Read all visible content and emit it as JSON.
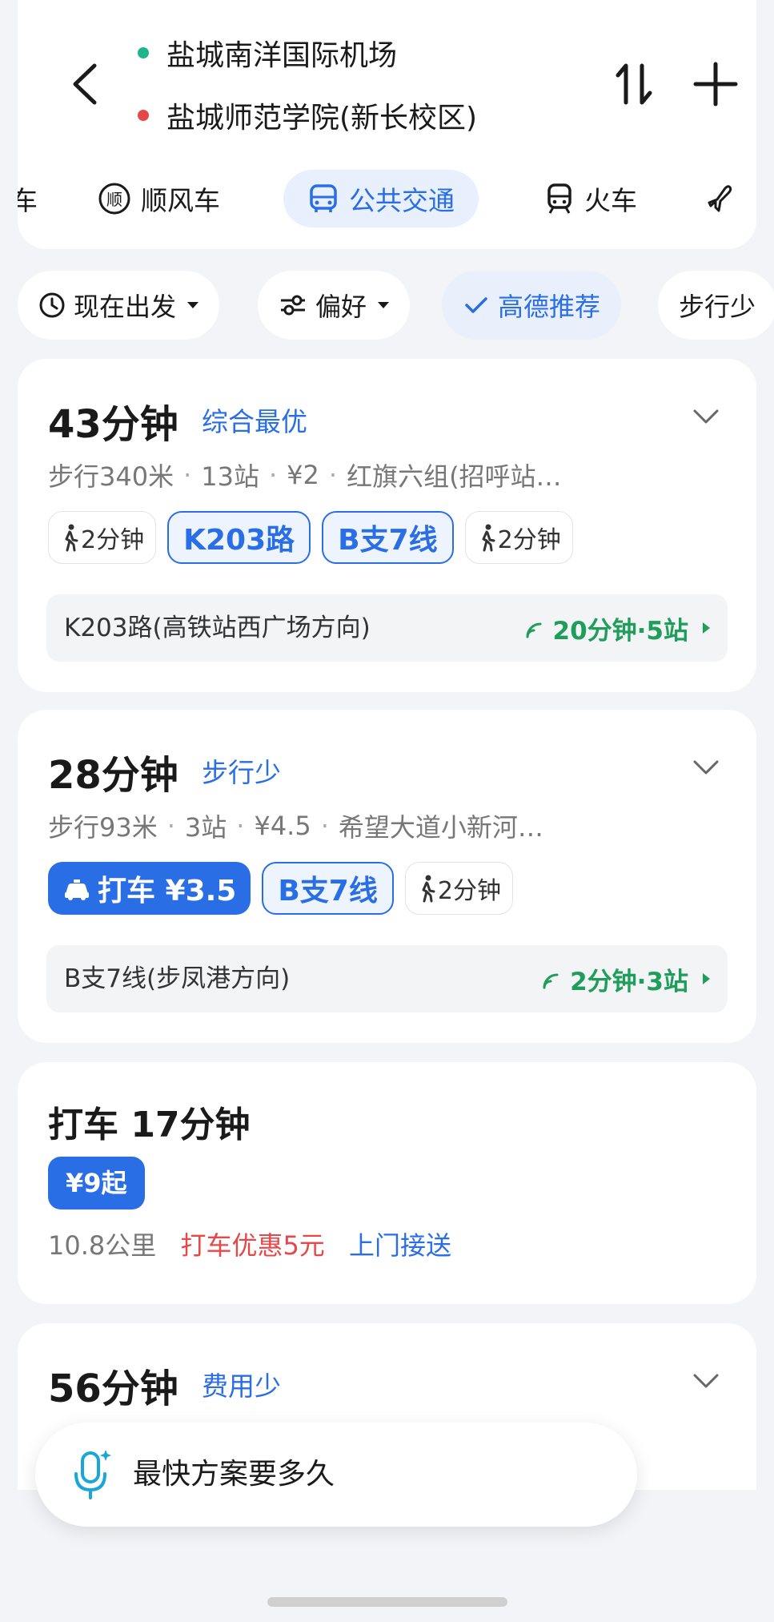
{
  "header": {
    "origin": "盐城南洋国际机场",
    "destination": "盐城师范学院(新长校区)",
    "origin_color": "#1fb58c",
    "destination_color": "#e8474a"
  },
  "modes": [
    {
      "label": "车"
    },
    {
      "label": "顺风车",
      "icon_text": "顺"
    },
    {
      "label": "公共交通",
      "active": true
    },
    {
      "label": "火车"
    },
    {
      "label": ""
    }
  ],
  "filters": {
    "depart": "现在出发",
    "pref": "偏好",
    "recommend": "高德推荐",
    "less_walk": "步行少"
  },
  "routes": [
    {
      "duration": "43分钟",
      "tag": "综合最优",
      "walk": "步行340米",
      "stops": "13站",
      "fare": "¥2",
      "station": "红旗六组(招呼站…",
      "segments": [
        {
          "type": "walk",
          "text": "2分钟"
        },
        {
          "type": "bus",
          "text": "K203路"
        },
        {
          "type": "bus",
          "text": "B支7线"
        },
        {
          "type": "walk",
          "text": "2分钟"
        }
      ],
      "line": "K203路(高铁站西广场方向)",
      "realtime": "20分钟·5站"
    },
    {
      "duration": "28分钟",
      "tag": "步行少",
      "walk": "步行93米",
      "stops": "3站",
      "fare": "¥4.5",
      "station": "希望大道小新河…",
      "segments": [
        {
          "type": "taxi",
          "text": "打车 ¥3.5"
        },
        {
          "type": "bus",
          "text": "B支7线"
        },
        {
          "type": "walk",
          "text": "2分钟"
        }
      ],
      "line": "B支7线(步凤港方向)",
      "realtime": "2分钟·3站"
    }
  ],
  "taxi": {
    "title": "打车 17分钟",
    "price": "¥9起",
    "distance": "10.8公里",
    "discount": "打车优惠5元",
    "pickup": "上门接送"
  },
  "route4": {
    "duration": "56分钟",
    "tag": "费用少"
  },
  "ask": {
    "text": "最快方案要多久"
  }
}
